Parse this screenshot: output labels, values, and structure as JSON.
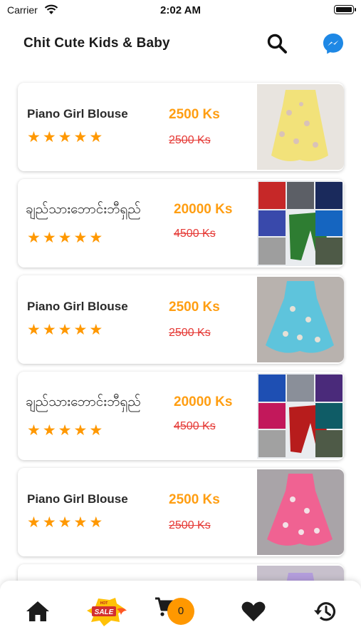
{
  "status_bar": {
    "carrier": "Carrier",
    "time": "2:02 AM"
  },
  "header": {
    "title": "Chit Cute Kids & Baby",
    "icons": [
      "search-icon",
      "messenger-icon"
    ]
  },
  "colors": {
    "accent": "#ff9800",
    "price": "#ff9e12",
    "old_price": "#e53935",
    "messenger": "#1e88e5"
  },
  "products": [
    {
      "name": "Piano Girl Blouse",
      "price": "2500 Ks",
      "old_price": "2500  Ks",
      "rating": 5
    },
    {
      "name": "ချည်သားဘောင်းဘီရှည်",
      "price": "20000 Ks",
      "old_price": "4500  Ks",
      "rating": 5
    },
    {
      "name": "Piano Girl Blouse",
      "price": "2500 Ks",
      "old_price": "2500  Ks",
      "rating": 5
    },
    {
      "name": "ချည်သားဘောင်းဘီရှည်",
      "price": "20000 Ks",
      "old_price": "4500  Ks",
      "rating": 5
    },
    {
      "name": "Piano Girl Blouse",
      "price": "2500 Ks",
      "old_price": "2500  Ks",
      "rating": 5
    }
  ],
  "bottom_nav": {
    "items": [
      "home-icon",
      "sale-icon",
      "cart-icon",
      "heart-icon",
      "history-icon"
    ],
    "cart_count": "0"
  }
}
